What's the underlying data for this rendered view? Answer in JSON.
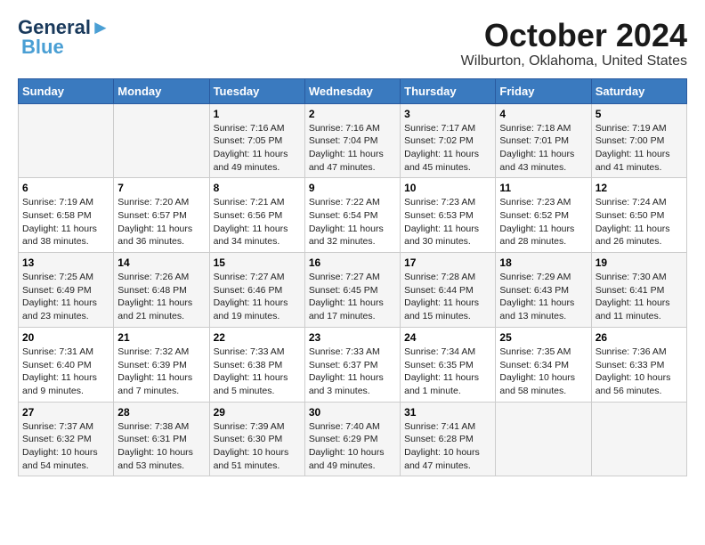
{
  "logo": {
    "line1": "General",
    "line2": "Blue"
  },
  "title": "October 2024",
  "subtitle": "Wilburton, Oklahoma, United States",
  "headers": [
    "Sunday",
    "Monday",
    "Tuesday",
    "Wednesday",
    "Thursday",
    "Friday",
    "Saturday"
  ],
  "weeks": [
    [
      {
        "day": "",
        "info": ""
      },
      {
        "day": "",
        "info": ""
      },
      {
        "day": "1",
        "info": "Sunrise: 7:16 AM\nSunset: 7:05 PM\nDaylight: 11 hours and 49 minutes."
      },
      {
        "day": "2",
        "info": "Sunrise: 7:16 AM\nSunset: 7:04 PM\nDaylight: 11 hours and 47 minutes."
      },
      {
        "day": "3",
        "info": "Sunrise: 7:17 AM\nSunset: 7:02 PM\nDaylight: 11 hours and 45 minutes."
      },
      {
        "day": "4",
        "info": "Sunrise: 7:18 AM\nSunset: 7:01 PM\nDaylight: 11 hours and 43 minutes."
      },
      {
        "day": "5",
        "info": "Sunrise: 7:19 AM\nSunset: 7:00 PM\nDaylight: 11 hours and 41 minutes."
      }
    ],
    [
      {
        "day": "6",
        "info": "Sunrise: 7:19 AM\nSunset: 6:58 PM\nDaylight: 11 hours and 38 minutes."
      },
      {
        "day": "7",
        "info": "Sunrise: 7:20 AM\nSunset: 6:57 PM\nDaylight: 11 hours and 36 minutes."
      },
      {
        "day": "8",
        "info": "Sunrise: 7:21 AM\nSunset: 6:56 PM\nDaylight: 11 hours and 34 minutes."
      },
      {
        "day": "9",
        "info": "Sunrise: 7:22 AM\nSunset: 6:54 PM\nDaylight: 11 hours and 32 minutes."
      },
      {
        "day": "10",
        "info": "Sunrise: 7:23 AM\nSunset: 6:53 PM\nDaylight: 11 hours and 30 minutes."
      },
      {
        "day": "11",
        "info": "Sunrise: 7:23 AM\nSunset: 6:52 PM\nDaylight: 11 hours and 28 minutes."
      },
      {
        "day": "12",
        "info": "Sunrise: 7:24 AM\nSunset: 6:50 PM\nDaylight: 11 hours and 26 minutes."
      }
    ],
    [
      {
        "day": "13",
        "info": "Sunrise: 7:25 AM\nSunset: 6:49 PM\nDaylight: 11 hours and 23 minutes."
      },
      {
        "day": "14",
        "info": "Sunrise: 7:26 AM\nSunset: 6:48 PM\nDaylight: 11 hours and 21 minutes."
      },
      {
        "day": "15",
        "info": "Sunrise: 7:27 AM\nSunset: 6:46 PM\nDaylight: 11 hours and 19 minutes."
      },
      {
        "day": "16",
        "info": "Sunrise: 7:27 AM\nSunset: 6:45 PM\nDaylight: 11 hours and 17 minutes."
      },
      {
        "day": "17",
        "info": "Sunrise: 7:28 AM\nSunset: 6:44 PM\nDaylight: 11 hours and 15 minutes."
      },
      {
        "day": "18",
        "info": "Sunrise: 7:29 AM\nSunset: 6:43 PM\nDaylight: 11 hours and 13 minutes."
      },
      {
        "day": "19",
        "info": "Sunrise: 7:30 AM\nSunset: 6:41 PM\nDaylight: 11 hours and 11 minutes."
      }
    ],
    [
      {
        "day": "20",
        "info": "Sunrise: 7:31 AM\nSunset: 6:40 PM\nDaylight: 11 hours and 9 minutes."
      },
      {
        "day": "21",
        "info": "Sunrise: 7:32 AM\nSunset: 6:39 PM\nDaylight: 11 hours and 7 minutes."
      },
      {
        "day": "22",
        "info": "Sunrise: 7:33 AM\nSunset: 6:38 PM\nDaylight: 11 hours and 5 minutes."
      },
      {
        "day": "23",
        "info": "Sunrise: 7:33 AM\nSunset: 6:37 PM\nDaylight: 11 hours and 3 minutes."
      },
      {
        "day": "24",
        "info": "Sunrise: 7:34 AM\nSunset: 6:35 PM\nDaylight: 11 hours and 1 minute."
      },
      {
        "day": "25",
        "info": "Sunrise: 7:35 AM\nSunset: 6:34 PM\nDaylight: 10 hours and 58 minutes."
      },
      {
        "day": "26",
        "info": "Sunrise: 7:36 AM\nSunset: 6:33 PM\nDaylight: 10 hours and 56 minutes."
      }
    ],
    [
      {
        "day": "27",
        "info": "Sunrise: 7:37 AM\nSunset: 6:32 PM\nDaylight: 10 hours and 54 minutes."
      },
      {
        "day": "28",
        "info": "Sunrise: 7:38 AM\nSunset: 6:31 PM\nDaylight: 10 hours and 53 minutes."
      },
      {
        "day": "29",
        "info": "Sunrise: 7:39 AM\nSunset: 6:30 PM\nDaylight: 10 hours and 51 minutes."
      },
      {
        "day": "30",
        "info": "Sunrise: 7:40 AM\nSunset: 6:29 PM\nDaylight: 10 hours and 49 minutes."
      },
      {
        "day": "31",
        "info": "Sunrise: 7:41 AM\nSunset: 6:28 PM\nDaylight: 10 hours and 47 minutes."
      },
      {
        "day": "",
        "info": ""
      },
      {
        "day": "",
        "info": ""
      }
    ]
  ]
}
